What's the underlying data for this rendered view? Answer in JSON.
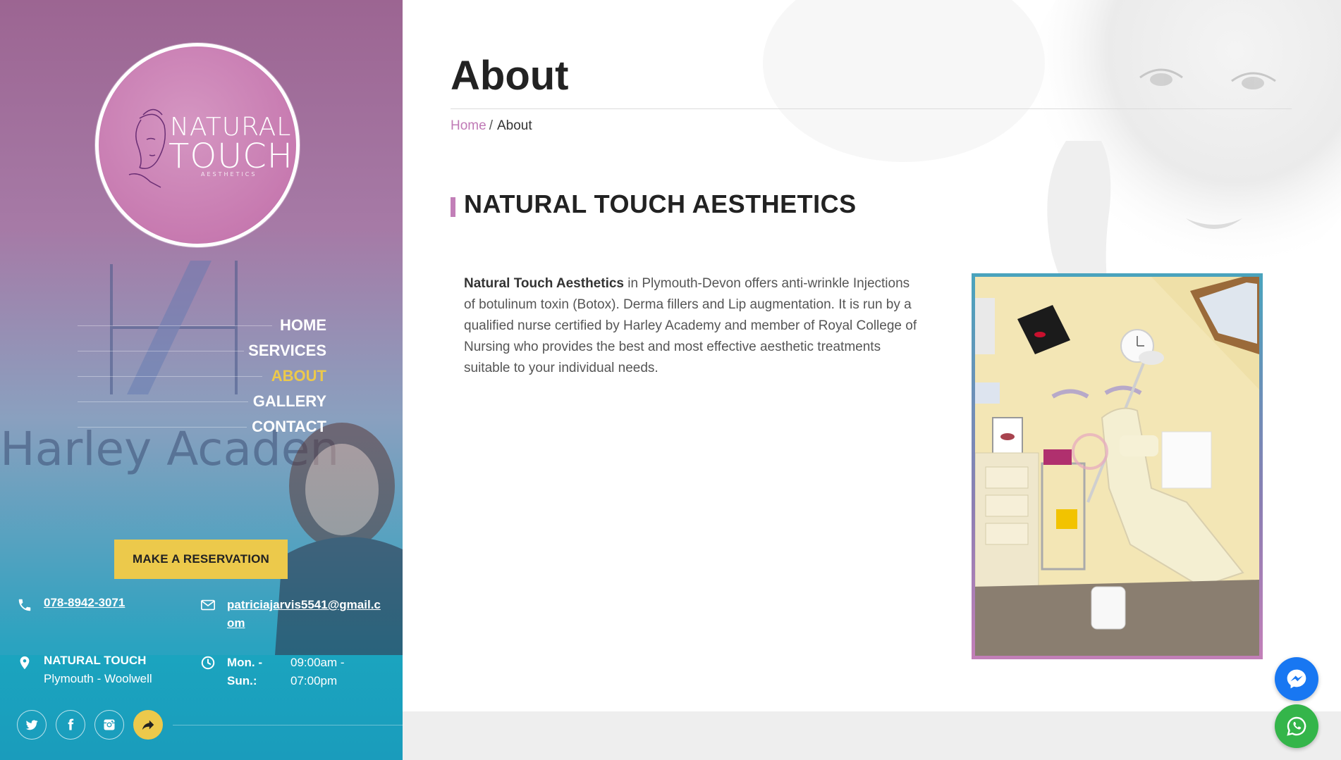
{
  "brand": {
    "logo_line1": "NATURAL",
    "logo_line2": "TOUCH",
    "logo_line3": "AESTHETICS",
    "background_sign_text": "Harley Acaden",
    "accent_color": "#ecc94b",
    "pink_color": "#c27fb8",
    "teal_color": "#1a9fbd"
  },
  "nav": {
    "items": [
      {
        "label": "HOME",
        "active": false
      },
      {
        "label": "SERVICES",
        "active": false
      },
      {
        "label": "ABOUT",
        "active": true
      },
      {
        "label": "GALLERY",
        "active": false
      },
      {
        "label": "CONTACT",
        "active": false
      }
    ]
  },
  "reservation": {
    "label": "MAKE A RESERVATION"
  },
  "contact": {
    "phone": "078-8942-3071",
    "email": "patriciajarvis5541@gmail.com",
    "address_title": "NATURAL TOUCH",
    "address_sub": "Plymouth - Woolwell",
    "hours_days": "Mon. - Sun.:",
    "hours_times": "09:00am - 07:00pm",
    "icons": [
      "phone-icon",
      "envelope-icon",
      "map-pin-icon",
      "clock-icon"
    ]
  },
  "social": {
    "icons": [
      "twitter-icon",
      "facebook-icon",
      "instagram-icon",
      "share-icon"
    ]
  },
  "page": {
    "title": "About",
    "breadcrumb_home": "Home",
    "breadcrumb_sep": "/",
    "breadcrumb_current": "About",
    "section_heading": "NATURAL TOUCH AESTHETICS",
    "about_bold": "Natural Touch Aesthetics",
    "about_text": " in Plymouth-Devon offers anti-wrinkle Injections of botulinum toxin (Botox). Derma fillers and Lip augmentation. It is run by a qualified nurse certified by Harley Academy and member of Royal College of Nursing who provides the best and most effective aesthetic treatments suitable to your individual needs."
  },
  "floating": {
    "messenger_icon": "messenger-icon",
    "whatsapp_icon": "whatsapp-icon"
  }
}
